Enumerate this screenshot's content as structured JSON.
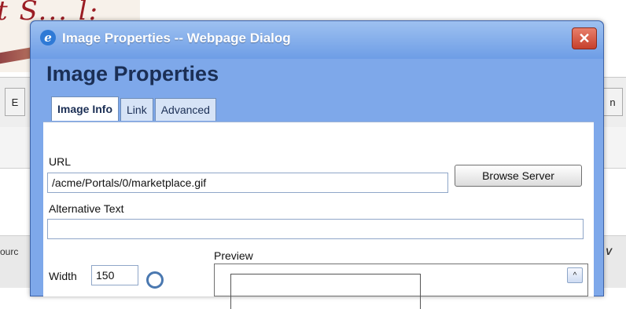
{
  "dialog": {
    "window_title": "Image Properties -- Webpage Dialog",
    "close_glyph": "✕",
    "heading": "Image Properties",
    "tabs": [
      {
        "label": "Image Info",
        "active": true
      },
      {
        "label": "Link",
        "active": false
      },
      {
        "label": "Advanced",
        "active": false
      }
    ],
    "url_label": "URL",
    "url_value": "/acme/Portals/0/marketplace.gif",
    "browse_button": "Browse Server",
    "alt_label": "Alternative Text",
    "alt_value": "",
    "width_label": "Width",
    "width_value": "150",
    "preview_label": "Preview",
    "scroll_up_glyph": "^"
  },
  "background": {
    "toolbar_left": "E",
    "toolbar_right": "n",
    "side_label": "ourc",
    "side_right": "V"
  },
  "colors": {
    "dialog_blue": "#7ea8ea",
    "title_text": "#ffffff",
    "heading_text": "#1b2f55",
    "close_red": "#c6402c"
  },
  "icons": [
    "ie-icon",
    "close-icon",
    "scroll-up-icon",
    "lock-icon"
  ]
}
